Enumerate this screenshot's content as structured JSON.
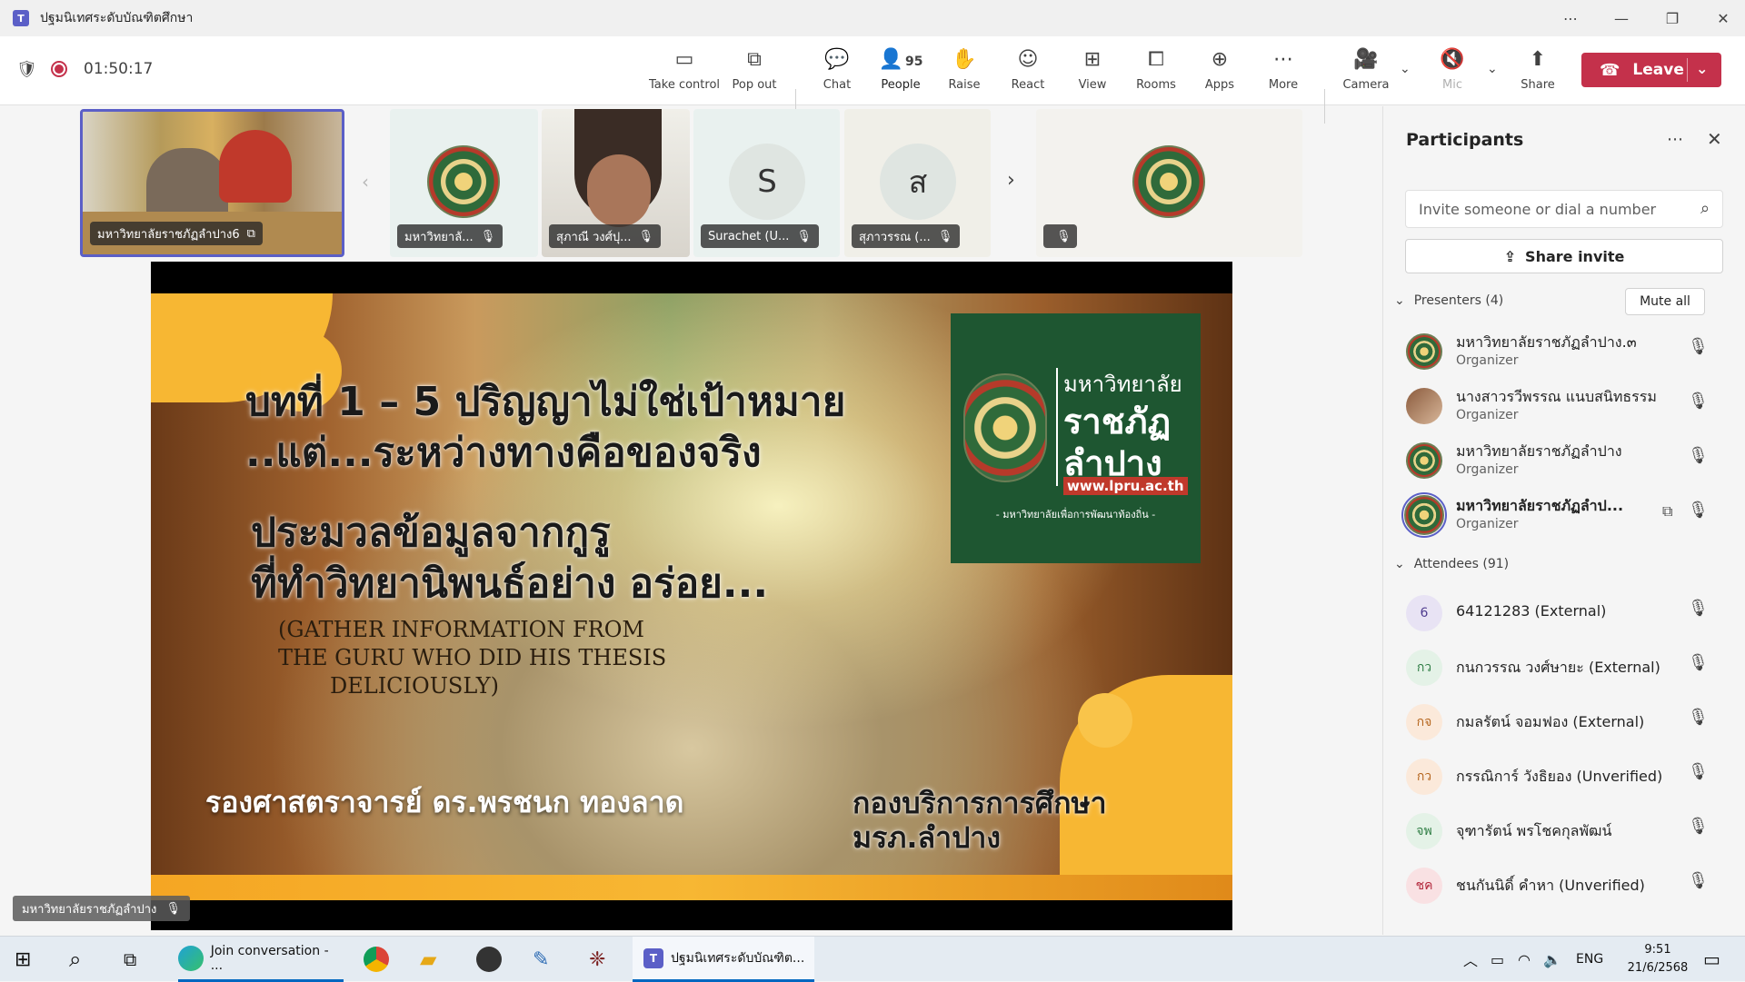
{
  "window": {
    "title": "ปฐมนิเทศระดับบัณฑิตศึกษา",
    "controls": [
      "⋯",
      "—",
      "❐",
      "✕"
    ]
  },
  "meeting": {
    "timer": "01:50:17"
  },
  "toolbar": {
    "take_control": "Take control",
    "pop_out": "Pop out",
    "chat": "Chat",
    "people": "People",
    "people_count": "95",
    "raise": "Raise",
    "react": "React",
    "view": "View",
    "rooms": "Rooms",
    "apps": "Apps",
    "more": "More",
    "camera": "Camera",
    "mic": "Mic",
    "share": "Share",
    "leave": "Leave"
  },
  "video_strip": {
    "tiles": [
      {
        "name": "มหาวิทยาลัยราชภัฏลำปาง6"
      },
      {
        "name": "มหาวิทยาลั..."
      },
      {
        "name": "สุภาณี วงศ์ปุ..."
      },
      {
        "name": "Surachet (U...",
        "initial": "S"
      },
      {
        "name": "สุภาวรรณ (...",
        "initial": "ส"
      },
      {
        "name": ""
      }
    ]
  },
  "slide": {
    "line1": "บทที่ 1 – 5 ปริญญาไม่ใช่เป้าหมาย",
    "line2": "..แต่...ระหว่างทางคือของจริง",
    "line3": "ประมวลข้อมูลจากกูรู",
    "line4": "ที่ทำวิทยานิพนธ์อย่าง อร่อย...",
    "english": [
      "(GATHER INFORMATION FROM",
      "THE GURU WHO DID HIS THESIS",
      "DELICIOUSLY)"
    ],
    "presenter": "รองศาสตราจารย์ ดร.พรชนก ทองลาด",
    "org_line1": "กองบริการการศึกษา",
    "org_line2": "มรภ.ลำปาง",
    "logo": {
      "title1": "มหาวิทยาลัย",
      "title2": "ราชภัฏ",
      "title3": "ลำปาง",
      "url": "www.lpru.ac.th",
      "tagline": "- มหาวิทยาลัยเพื่อการพัฒนาท้องถิ่น -"
    }
  },
  "speaker_label": "มหาวิทยาลัยราชภัฏลำปาง",
  "participants": {
    "title": "Participants",
    "invite_placeholder": "Invite someone or dial a number",
    "share_invite": "Share invite",
    "presenters_label": "Presenters (4)",
    "mute_all": "Mute all",
    "presenters": [
      {
        "name": "มหาวิทยาลัยราชภัฏลำปาง.๓",
        "role": "Organizer"
      },
      {
        "name": "นางสาวรวีพรรณ แนบสนิทธรรม",
        "role": "Organizer"
      },
      {
        "name": "มหาวิทยาลัยราชภัฏลำปาง",
        "role": "Organizer"
      },
      {
        "name": "มหาวิทยาลัยราชภัฏลำป...",
        "role": "Organizer"
      }
    ],
    "attendees_label": "Attendees (91)",
    "attendees": [
      {
        "initials": "6",
        "name": "64121283 (External)",
        "color": "#e8e3f4",
        "text_color": "#4f3c8f"
      },
      {
        "initials": "กว",
        "name": "กนกวรรณ วงศ์ษายะ (External)",
        "color": "#e4f2e7",
        "text_color": "#2e7d44"
      },
      {
        "initials": "กจ",
        "name": "กมลรัตน์ จอมฟอง (External)",
        "color": "#fbe9da",
        "text_color": "#b5651d"
      },
      {
        "initials": "กว",
        "name": "กรรณิการ์ วังธิยอง (Unverified)",
        "color": "#fbe9da",
        "text_color": "#b5651d"
      },
      {
        "initials": "จพ",
        "name": "จุฑารัตน์ พรโชคกุลพัฒน์",
        "color": "#e4f2e7",
        "text_color": "#2e7d44"
      },
      {
        "initials": "ชค",
        "name": "ชนกันนิดิ์ คำหา (Unverified)",
        "color": "#f9e1e3",
        "text_color": "#b3283c"
      }
    ]
  },
  "taskbar": {
    "edge_label": "Join conversation - ...",
    "teams_label": "ปฐมนิเทศระดับบัณฑิต...",
    "lang": "ENG",
    "time": "9:51",
    "date": "21/6/2568"
  }
}
